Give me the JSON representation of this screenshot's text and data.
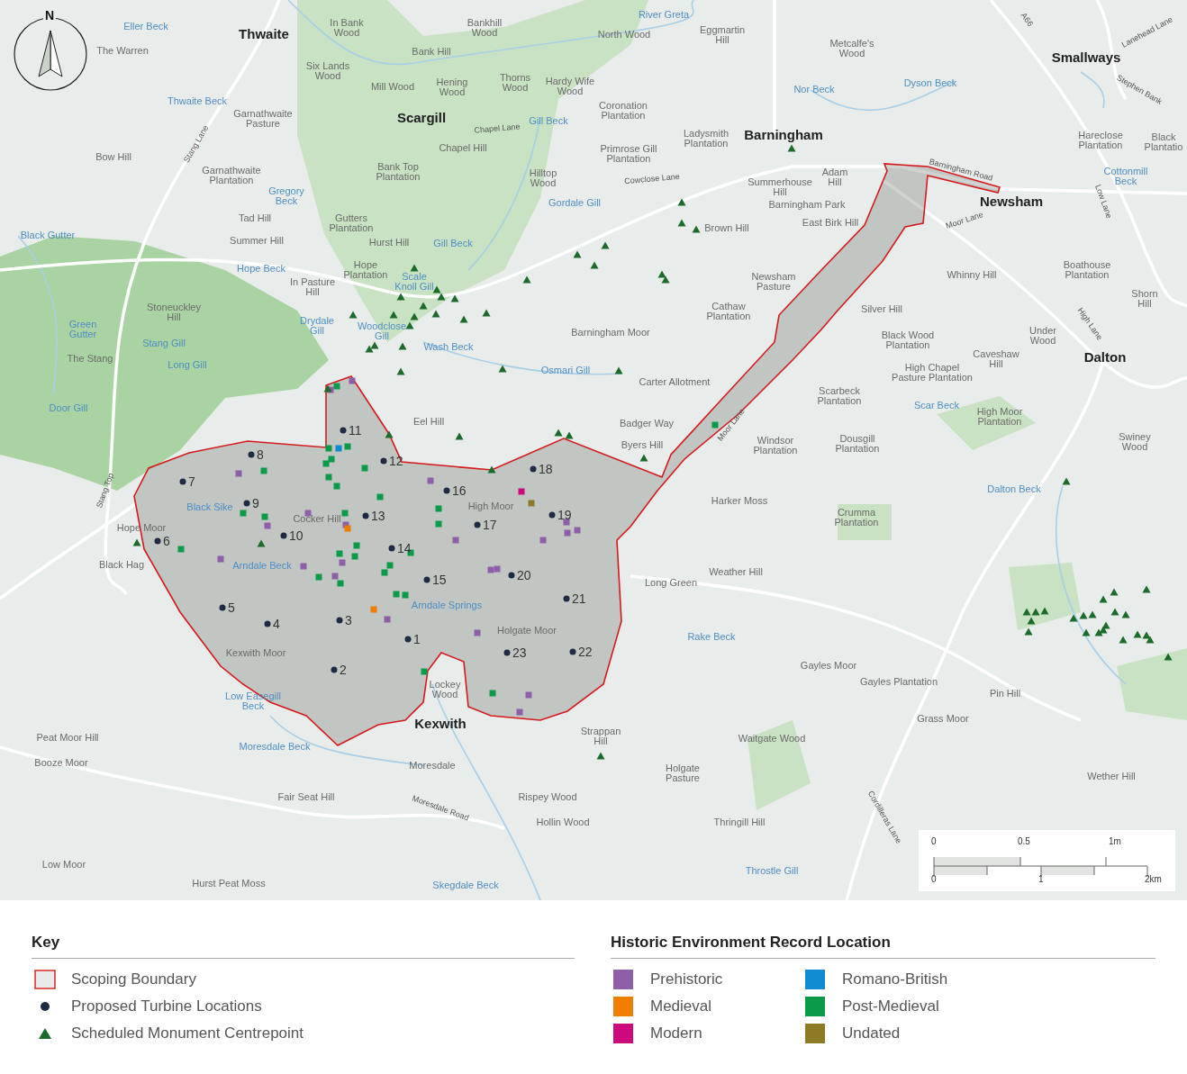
{
  "map": {
    "north_arrow": {
      "label": "N"
    },
    "labels": [
      {
        "kind": "town",
        "lines": [
          "Thwaite"
        ]
      },
      {
        "kind": "water",
        "lines": [
          "Eller Beck"
        ]
      },
      {
        "kind": "place",
        "lines": [
          "The Warren"
        ]
      },
      {
        "kind": "place",
        "lines": [
          "In Bank",
          "Wood"
        ]
      },
      {
        "kind": "place",
        "lines": [
          "Bankhill",
          "Wood"
        ]
      },
      {
        "kind": "water",
        "lines": [
          "River Greta"
        ]
      },
      {
        "kind": "place",
        "lines": [
          "North Wood"
        ]
      },
      {
        "kind": "place",
        "lines": [
          "Eggmartin",
          "Hill"
        ]
      },
      {
        "kind": "place",
        "lines": [
          "Metcalfe's",
          "Wood"
        ]
      },
      {
        "kind": "town",
        "lines": [
          "Smallways"
        ]
      },
      {
        "kind": "road",
        "lines": [
          "A66"
        ]
      },
      {
        "kind": "road",
        "lines": [
          "Lanehead Lane"
        ]
      },
      {
        "kind": "place",
        "lines": [
          "Six Lands",
          "Wood"
        ]
      },
      {
        "kind": "place",
        "lines": [
          "Bank Hill"
        ]
      },
      {
        "kind": "place",
        "lines": [
          "Mill Wood"
        ]
      },
      {
        "kind": "place",
        "lines": [
          "Hening",
          "Wood"
        ]
      },
      {
        "kind": "place",
        "lines": [
          "Thorns",
          "Wood"
        ]
      },
      {
        "kind": "place",
        "lines": [
          "Hardy Wife",
          "Wood"
        ]
      },
      {
        "kind": "place",
        "lines": [
          "Coronation",
          "Plantation"
        ]
      },
      {
        "kind": "water",
        "lines": [
          "Nor Beck"
        ]
      },
      {
        "kind": "water",
        "lines": [
          "Dyson Beck"
        ]
      },
      {
        "kind": "road",
        "lines": [
          "Stephen Bank"
        ]
      },
      {
        "kind": "water",
        "lines": [
          "Thwaite Beck"
        ]
      },
      {
        "kind": "place",
        "lines": [
          "Garnathwaite",
          "Pasture"
        ]
      },
      {
        "kind": "town",
        "lines": [
          "Scargill"
        ]
      },
      {
        "kind": "road",
        "lines": [
          "Chapel Lane"
        ]
      },
      {
        "kind": "water",
        "lines": [
          "Gill Beck"
        ]
      },
      {
        "kind": "place",
        "lines": [
          "Ladysmith",
          "Plantation"
        ]
      },
      {
        "kind": "town",
        "lines": [
          "Barningham"
        ]
      },
      {
        "kind": "place",
        "lines": [
          "Hareclose",
          "Plantation"
        ]
      },
      {
        "kind": "place",
        "lines": [
          "Black",
          "Plantatio"
        ]
      },
      {
        "kind": "road",
        "lines": [
          "Stang Lane"
        ]
      },
      {
        "kind": "place",
        "lines": [
          "Bow Hill"
        ]
      },
      {
        "kind": "place",
        "lines": [
          "Chapel Hill"
        ]
      },
      {
        "kind": "place",
        "lines": [
          "Primrose Gill",
          "Plantation"
        ]
      },
      {
        "kind": "place",
        "lines": [
          "Garnathwaite",
          "Plantation"
        ]
      },
      {
        "kind": "place",
        "lines": [
          "Bank Top",
          "Plantation"
        ]
      },
      {
        "kind": "place",
        "lines": [
          "Hilltop",
          "Wood"
        ]
      },
      {
        "kind": "road",
        "lines": [
          "Cowclose Lane"
        ]
      },
      {
        "kind": "place",
        "lines": [
          "Summerhouse",
          "Hill"
        ]
      },
      {
        "kind": "place",
        "lines": [
          "Adam",
          "Hill"
        ]
      },
      {
        "kind": "road",
        "lines": [
          "Barningham Road"
        ]
      },
      {
        "kind": "water",
        "lines": [
          "Cottonmill",
          "Beck"
        ]
      },
      {
        "kind": "water",
        "lines": [
          "Gregory",
          "Beck"
        ]
      },
      {
        "kind": "water",
        "lines": [
          "Gordale Gill"
        ]
      },
      {
        "kind": "place",
        "lines": [
          "Barningham Park"
        ]
      },
      {
        "kind": "town",
        "lines": [
          "Newsham"
        ]
      },
      {
        "kind": "road",
        "lines": [
          "Low Lane"
        ]
      },
      {
        "kind": "place",
        "lines": [
          "Tad Hill"
        ]
      },
      {
        "kind": "place",
        "lines": [
          "Gutters",
          "Plantation"
        ]
      },
      {
        "kind": "place",
        "lines": [
          "Brown Hill"
        ]
      },
      {
        "kind": "place",
        "lines": [
          "East Birk Hill"
        ]
      },
      {
        "kind": "road",
        "lines": [
          "Moor Lane"
        ]
      },
      {
        "kind": "water",
        "lines": [
          "Black Gutter"
        ]
      },
      {
        "kind": "place",
        "lines": [
          "Summer Hill"
        ]
      },
      {
        "kind": "place",
        "lines": [
          "Hurst Hill"
        ]
      },
      {
        "kind": "water",
        "lines": [
          "Gill Beck"
        ]
      },
      {
        "kind": "water",
        "lines": [
          "Hope Beck"
        ]
      },
      {
        "kind": "place",
        "lines": [
          "Hope",
          "Plantation"
        ]
      },
      {
        "kind": "water",
        "lines": [
          "Scale",
          "Knoll Gill"
        ]
      },
      {
        "kind": "place",
        "lines": [
          "Whinny Hill"
        ]
      },
      {
        "kind": "place",
        "lines": [
          "Boathouse",
          "Plantation"
        ]
      },
      {
        "kind": "place",
        "lines": [
          "In Pasture",
          "Hill"
        ]
      },
      {
        "kind": "place",
        "lines": [
          "Newsham",
          "Pasture"
        ]
      },
      {
        "kind": "place",
        "lines": [
          "Stoneuckley",
          "Hill"
        ]
      },
      {
        "kind": "place",
        "lines": [
          "Cathaw",
          "Plantation"
        ]
      },
      {
        "kind": "place",
        "lines": [
          "Silver Hill"
        ]
      },
      {
        "kind": "place",
        "lines": [
          "Shorn",
          "Hill"
        ]
      },
      {
        "kind": "water",
        "lines": [
          "Green",
          "Gutter"
        ]
      },
      {
        "kind": "water",
        "lines": [
          "Drydale",
          "Gill"
        ]
      },
      {
        "kind": "water",
        "lines": [
          "Woodclose",
          "Gill"
        ]
      },
      {
        "kind": "road",
        "lines": [
          "High Lane"
        ]
      },
      {
        "kind": "place",
        "lines": [
          "Barningham Moor"
        ]
      },
      {
        "kind": "water",
        "lines": [
          "Stang Gill"
        ]
      },
      {
        "kind": "place",
        "lines": [
          "Black Wood",
          "Plantation"
        ]
      },
      {
        "kind": "place",
        "lines": [
          "Under",
          "Wood"
        ]
      },
      {
        "kind": "water",
        "lines": [
          "Wash Beck"
        ]
      },
      {
        "kind": "place",
        "lines": [
          "The Stang"
        ]
      },
      {
        "kind": "water",
        "lines": [
          "Long Gill"
        ]
      },
      {
        "kind": "water",
        "lines": [
          "Osmari Gill"
        ]
      },
      {
        "kind": "place",
        "lines": [
          "Caveshaw",
          "Hill"
        ]
      },
      {
        "kind": "town",
        "lines": [
          "Dalton"
        ]
      },
      {
        "kind": "place",
        "lines": [
          "Carter Allotment"
        ]
      },
      {
        "kind": "place",
        "lines": [
          "High Chapel",
          "Pasture Plantation"
        ]
      },
      {
        "kind": "water",
        "lines": [
          "Door Gill"
        ]
      },
      {
        "kind": "place",
        "lines": [
          "Scarbeck",
          "Plantation"
        ]
      },
      {
        "kind": "water",
        "lines": [
          "Scar Beck"
        ]
      },
      {
        "kind": "place",
        "lines": [
          "Eel Hill"
        ]
      },
      {
        "kind": "place",
        "lines": [
          "Badger Way"
        ]
      },
      {
        "kind": "road",
        "lines": [
          "Moor Lane"
        ]
      },
      {
        "kind": "place",
        "lines": [
          "High Moor",
          "Plantation"
        ]
      },
      {
        "kind": "place",
        "lines": [
          "Byers Hill"
        ]
      },
      {
        "kind": "place",
        "lines": [
          "Windsor",
          "Plantation"
        ]
      },
      {
        "kind": "place",
        "lines": [
          "Dousgill",
          "Plantation"
        ]
      },
      {
        "kind": "place",
        "lines": [
          "Swiney",
          "Wood"
        ]
      },
      {
        "kind": "road",
        "lines": [
          "Stang Top"
        ]
      },
      {
        "kind": "water",
        "lines": [
          "Dalton Beck"
        ]
      },
      {
        "kind": "water",
        "lines": [
          "Black Sike"
        ]
      },
      {
        "kind": "place",
        "lines": [
          "High Moor"
        ]
      },
      {
        "kind": "place",
        "lines": [
          "Harker Moss"
        ]
      },
      {
        "kind": "place",
        "lines": [
          "Hope Moor"
        ]
      },
      {
        "kind": "place",
        "lines": [
          "Cocker Hill"
        ]
      },
      {
        "kind": "place",
        "lines": [
          "Crumma",
          "Plantation"
        ]
      },
      {
        "kind": "place",
        "lines": [
          "Black Hag"
        ]
      },
      {
        "kind": "water",
        "lines": [
          "Arndale Beck"
        ]
      },
      {
        "kind": "place",
        "lines": [
          "Long Green"
        ]
      },
      {
        "kind": "place",
        "lines": [
          "Weather Hill"
        ]
      },
      {
        "kind": "water",
        "lines": [
          "Arndale Springs"
        ]
      },
      {
        "kind": "place",
        "lines": [
          "Holgate Moor"
        ]
      },
      {
        "kind": "water",
        "lines": [
          "Rake Beck"
        ]
      },
      {
        "kind": "place",
        "lines": [
          "Kexwith Moor"
        ]
      },
      {
        "kind": "place",
        "lines": [
          "Gayles Moor"
        ]
      },
      {
        "kind": "water",
        "lines": [
          "Low Easegill",
          "Beck"
        ]
      },
      {
        "kind": "place",
        "lines": [
          "Lockey",
          "Wood"
        ]
      },
      {
        "kind": "place",
        "lines": [
          "Gayles Plantation"
        ]
      },
      {
        "kind": "place",
        "lines": [
          "Pin Hill"
        ]
      },
      {
        "kind": "town",
        "lines": [
          "Kexwith"
        ]
      },
      {
        "kind": "place",
        "lines": [
          "Grass Moor"
        ]
      },
      {
        "kind": "place",
        "lines": [
          "Peat Moor Hill"
        ]
      },
      {
        "kind": "water",
        "lines": [
          "Moresdale Beck"
        ]
      },
      {
        "kind": "place",
        "lines": [
          "Strappan",
          "Hill"
        ]
      },
      {
        "kind": "place",
        "lines": [
          "Waitgate Wood"
        ]
      },
      {
        "kind": "place",
        "lines": [
          "Booze Moor"
        ]
      },
      {
        "kind": "place",
        "lines": [
          "Moresdale"
        ]
      },
      {
        "kind": "place",
        "lines": [
          "Holgate",
          "Pasture"
        ]
      },
      {
        "kind": "place",
        "lines": [
          "Wether Hill"
        ]
      },
      {
        "kind": "place",
        "lines": [
          "Fair Seat Hill"
        ]
      },
      {
        "kind": "road",
        "lines": [
          "Moresdale Road"
        ]
      },
      {
        "kind": "place",
        "lines": [
          "Rispey Wood"
        ]
      },
      {
        "kind": "place",
        "lines": [
          "Hollin Wood"
        ]
      },
      {
        "kind": "place",
        "lines": [
          "Thringill Hill"
        ]
      },
      {
        "kind": "road",
        "lines": [
          "Cordilleras Lane"
        ]
      },
      {
        "kind": "place",
        "lines": [
          "Low Moor"
        ]
      },
      {
        "kind": "water",
        "lines": [
          "Throstle Gill"
        ]
      },
      {
        "kind": "place",
        "lines": [
          "Hurst Peat Moss"
        ]
      },
      {
        "kind": "water",
        "lines": [
          "Skegdale Beck"
        ]
      }
    ],
    "turbines": [
      {
        "label": "1"
      },
      {
        "label": "2"
      },
      {
        "label": "3"
      },
      {
        "label": "4"
      },
      {
        "label": "5"
      },
      {
        "label": "6"
      },
      {
        "label": "7"
      },
      {
        "label": "8"
      },
      {
        "label": "9"
      },
      {
        "label": "10"
      },
      {
        "label": "11"
      },
      {
        "label": "12"
      },
      {
        "label": "13"
      },
      {
        "label": "14"
      },
      {
        "label": "15"
      },
      {
        "label": "16"
      },
      {
        "label": "17"
      },
      {
        "label": "18"
      },
      {
        "label": "19"
      },
      {
        "label": "20"
      },
      {
        "label": "21"
      },
      {
        "label": "22"
      },
      {
        "label": "23"
      }
    ],
    "scale_bar": {
      "top_labels": [
        "0",
        "0.5",
        "1m"
      ],
      "bottom_labels": [
        "0",
        "1",
        "2km"
      ]
    }
  },
  "key": {
    "title": "Key",
    "items": [
      {
        "kind": "boundary",
        "label": "Scoping Boundary"
      },
      {
        "kind": "turbine",
        "label": "Proposed Turbine Locations"
      },
      {
        "kind": "monument",
        "label": "Scheduled Monument Centrepoint"
      }
    ]
  },
  "her_legend": {
    "title": "Historic Environment Record Location",
    "items": [
      {
        "label": "Prehistoric",
        "color": "#8e5fa8"
      },
      {
        "label": "Medieval",
        "color": "#ee7d00"
      },
      {
        "label": "Modern",
        "color": "#cc0a7e"
      },
      {
        "label": "Romano-British",
        "color": "#0f8bd1"
      },
      {
        "label": "Post-Medieval",
        "color": "#0a9a48"
      },
      {
        "label": "Undated",
        "color": "#8c7a24"
      }
    ]
  }
}
